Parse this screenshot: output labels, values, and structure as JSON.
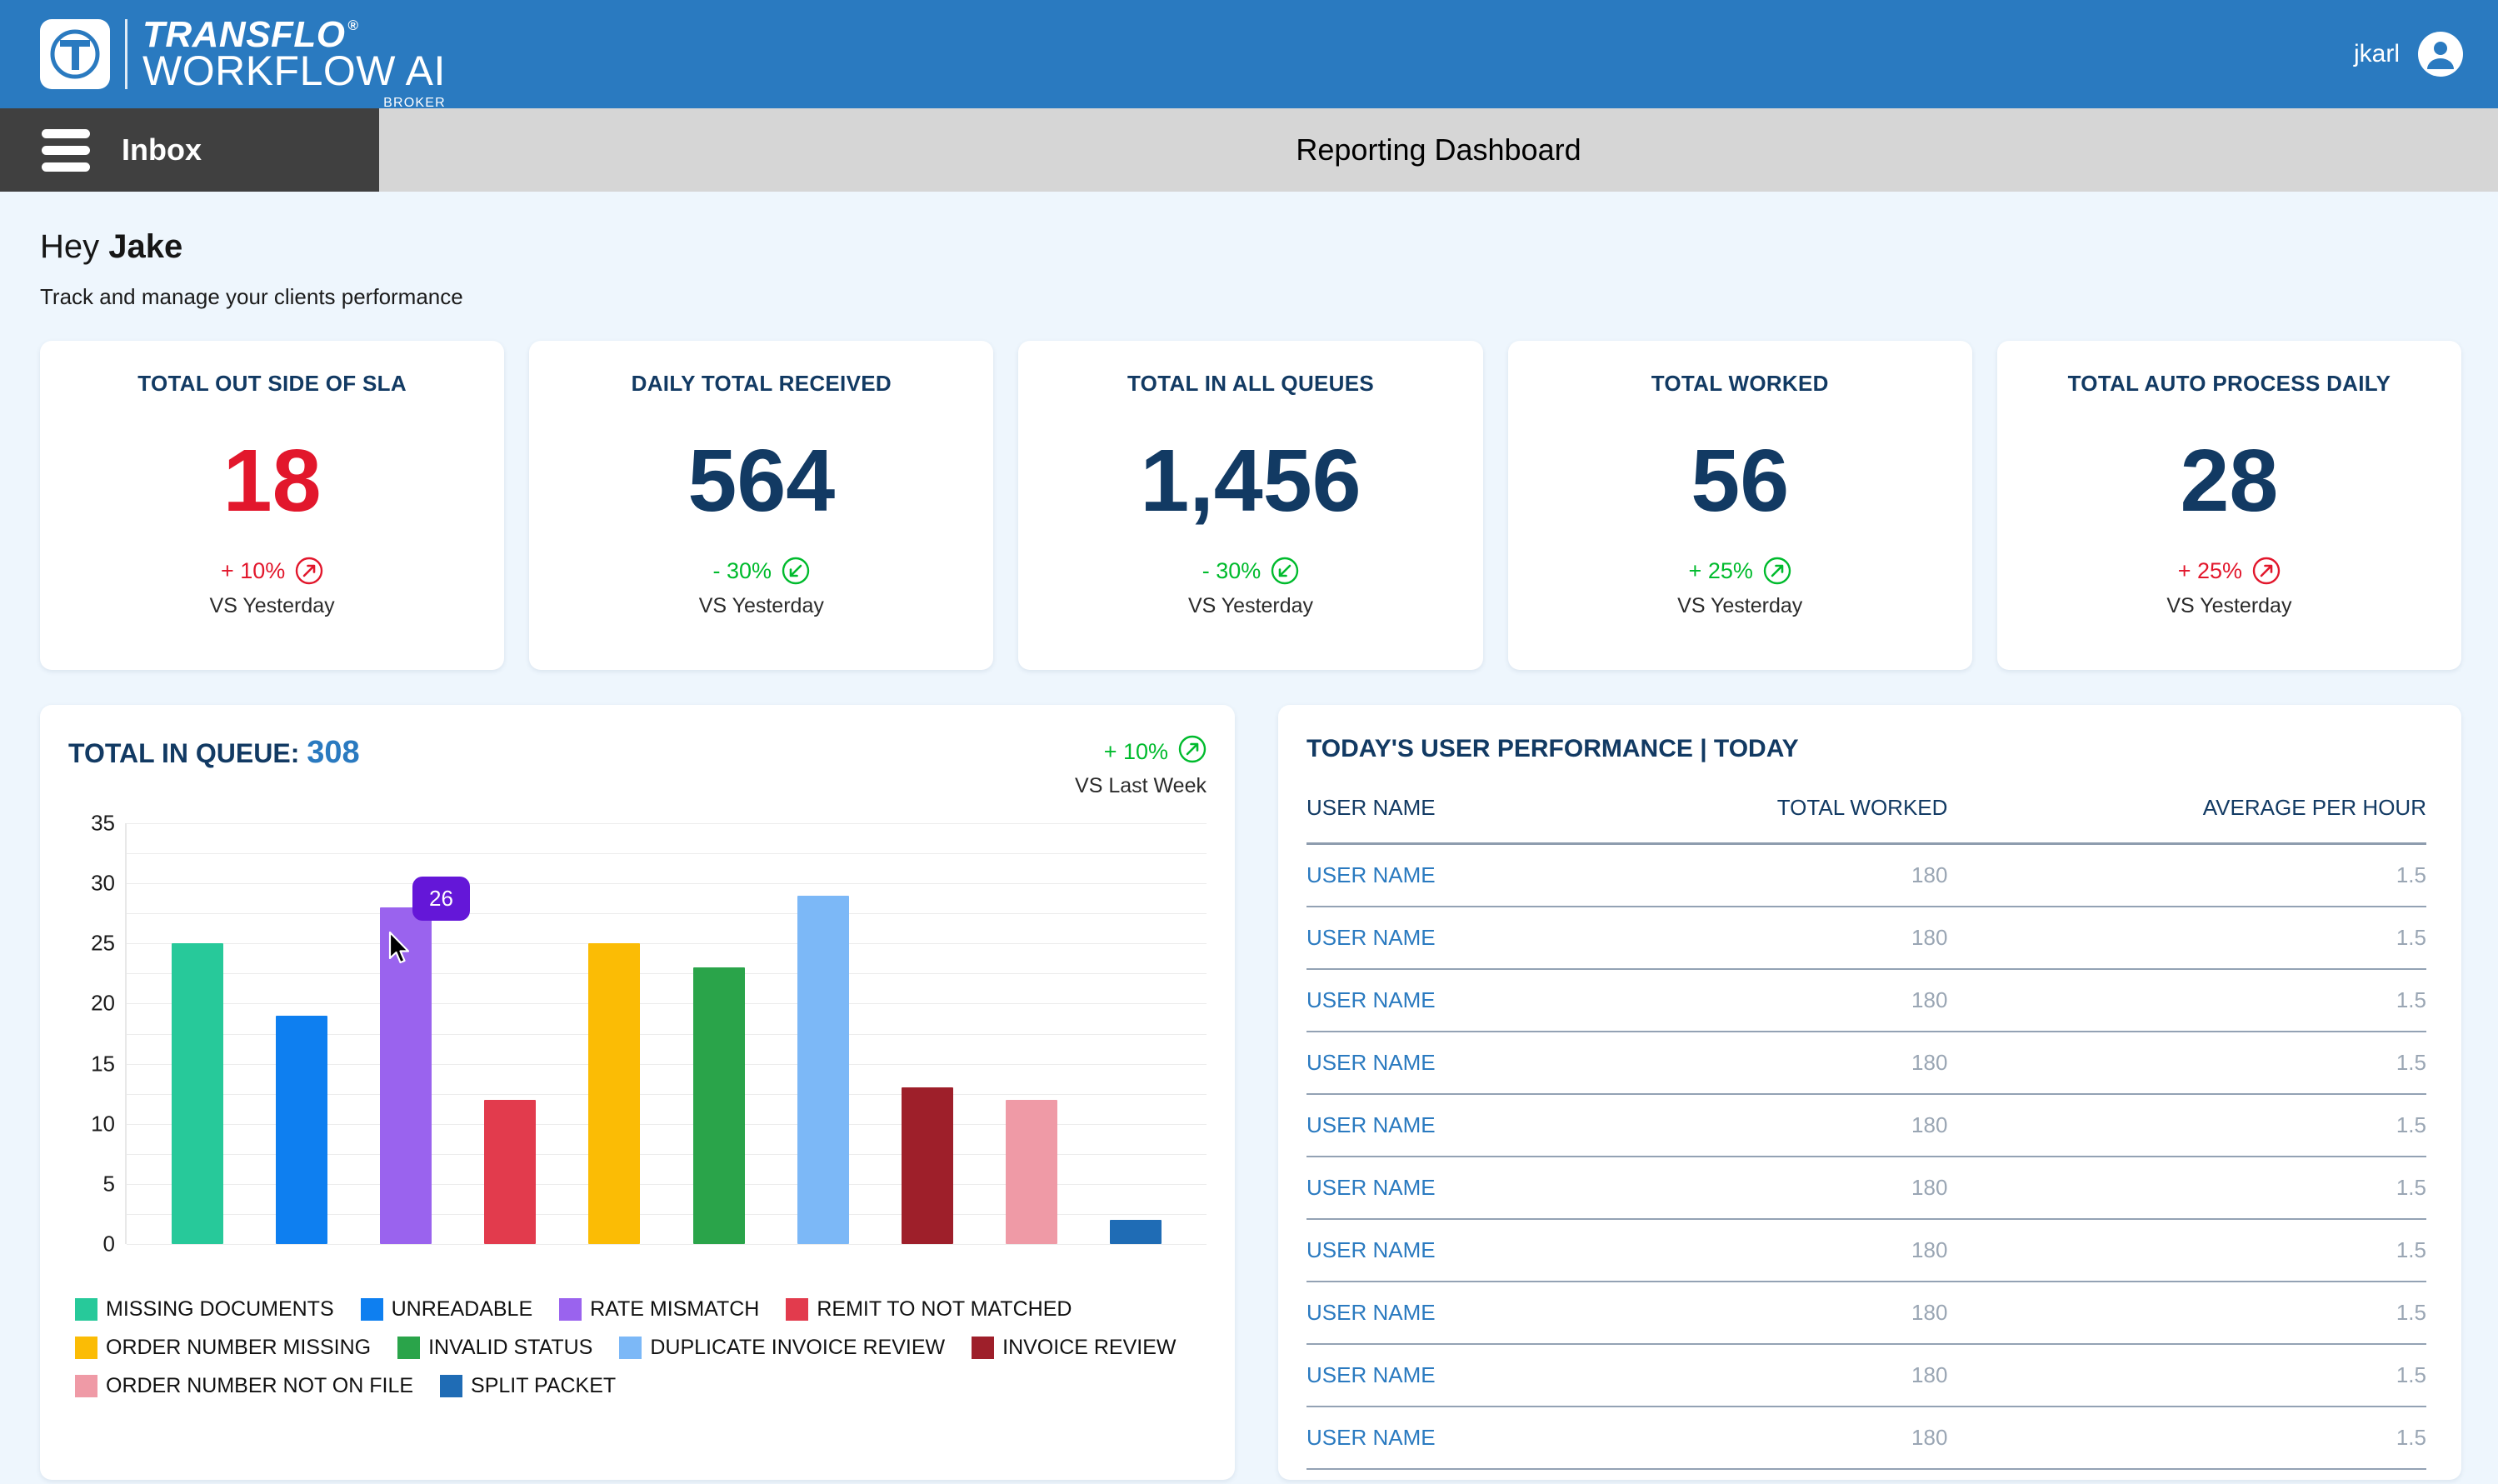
{
  "brand": {
    "logo_mark_icon": "transflo-t-logo-icon",
    "name_top": "TRANSFLO",
    "registered": "®",
    "name_bottom": "WORKFLOW AI",
    "tagline": "BROKER",
    "user_name": "jkarl",
    "avatar_icon": "user-avatar-icon",
    "bar_color": "#2a7ac0"
  },
  "nav": {
    "menu_icon": "hamburger-menu-icon",
    "inbox_label": "Inbox",
    "page_title": "Reporting Dashboard"
  },
  "page": {
    "greeting_prefix": "Hey ",
    "greeting_name": "Jake",
    "subtitle": "Track and manage your clients performance"
  },
  "kpis": [
    {
      "title": "TOTAL OUT SIDE OF SLA",
      "value": "18",
      "value_color": "red",
      "delta": "+ 10%",
      "delta_color": "red",
      "delta_icon": "arrow-up-right-circle-icon",
      "sub": "VS Yesterday"
    },
    {
      "title": "DAILY TOTAL RECEIVED",
      "value": "564",
      "value_color": "navy",
      "delta": "- 30%",
      "delta_color": "green",
      "delta_icon": "arrow-down-left-circle-icon",
      "sub": "VS Yesterday"
    },
    {
      "title": "TOTAL IN ALL QUEUES",
      "value": "1,456",
      "value_color": "navy",
      "delta": "- 30%",
      "delta_color": "green",
      "delta_icon": "arrow-down-left-circle-icon",
      "sub": "VS Yesterday"
    },
    {
      "title": "TOTAL WORKED",
      "value": "56",
      "value_color": "navy",
      "delta": "+ 25%",
      "delta_color": "green",
      "delta_icon": "arrow-up-right-circle-icon",
      "sub": "VS Yesterday"
    },
    {
      "title": "TOTAL AUTO PROCESS DAILY",
      "value": "28",
      "value_color": "navy",
      "delta": "+ 25%",
      "delta_color": "red",
      "delta_icon": "arrow-up-right-circle-icon",
      "sub": "VS Yesterday"
    }
  ],
  "chart_panel": {
    "title_label": "TOTAL IN QUEUE:",
    "title_value": "308",
    "delta": "+ 10%",
    "delta_icon": "arrow-up-right-circle-icon",
    "delta_sub": "VS Last Week",
    "tooltip_value": "26",
    "tooltip_color": "#6417d8",
    "cursor_icon": "mouse-pointer-icon"
  },
  "chart_data": {
    "type": "bar",
    "title": "TOTAL IN QUEUE: 308",
    "xlabel": "",
    "ylabel": "",
    "ylim": [
      0,
      35
    ],
    "yticks": [
      0,
      5,
      10,
      15,
      20,
      25,
      30,
      35
    ],
    "grid": true,
    "legend_position": "bottom",
    "categories": [
      "MISSING DOCUMENTS",
      "UNREADABLE",
      "RATE MISMATCH",
      "REMIT TO NOT MATCHED",
      "ORDER NUMBER MISSING",
      "INVALID STATUS",
      "DUPLICATE INVOICE REVIEW",
      "INVOICE REVIEW",
      "ORDER NUMBER NOT ON FILE",
      "SPLIT PACKET"
    ],
    "values": [
      25,
      19,
      28,
      12,
      25,
      23,
      29,
      13,
      12,
      2
    ],
    "colors": [
      "#27c99a",
      "#0e7ff0",
      "#9a63ee",
      "#e23b4d",
      "#fbbc05",
      "#2aa44a",
      "#7cb8f7",
      "#9e1f2a",
      "#ef9aa6",
      "#1f6cb5"
    ],
    "highlighted_index": 2,
    "highlighted_value": 26
  },
  "table_panel": {
    "title": "TODAY'S USER PERFORMANCE | TODAY",
    "columns": [
      "USER NAME",
      "TOTAL WORKED",
      "AVERAGE PER HOUR"
    ],
    "rows": [
      {
        "user": "USER NAME",
        "total_worked": "180",
        "avg_per_hour": "1.5"
      },
      {
        "user": "USER NAME",
        "total_worked": "180",
        "avg_per_hour": "1.5"
      },
      {
        "user": "USER NAME",
        "total_worked": "180",
        "avg_per_hour": "1.5"
      },
      {
        "user": "USER NAME",
        "total_worked": "180",
        "avg_per_hour": "1.5"
      },
      {
        "user": "USER NAME",
        "total_worked": "180",
        "avg_per_hour": "1.5"
      },
      {
        "user": "USER NAME",
        "total_worked": "180",
        "avg_per_hour": "1.5"
      },
      {
        "user": "USER NAME",
        "total_worked": "180",
        "avg_per_hour": "1.5"
      },
      {
        "user": "USER NAME",
        "total_worked": "180",
        "avg_per_hour": "1.5"
      },
      {
        "user": "USER NAME",
        "total_worked": "180",
        "avg_per_hour": "1.5"
      },
      {
        "user": "USER NAME",
        "total_worked": "180",
        "avg_per_hour": "1.5"
      }
    ]
  }
}
